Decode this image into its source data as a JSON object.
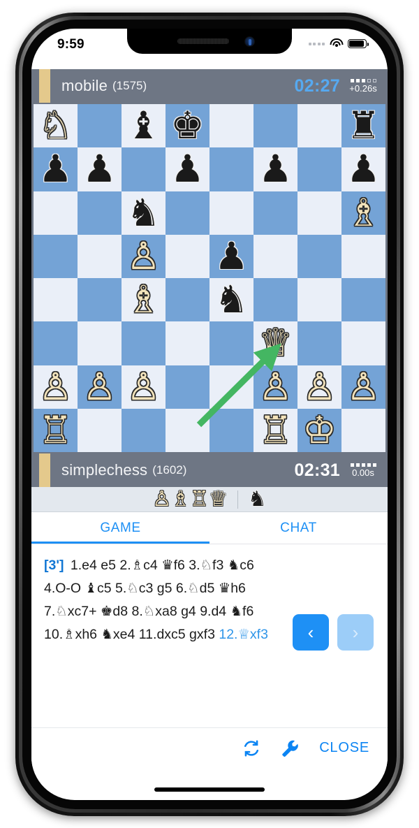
{
  "status_bar": {
    "time": "9:59",
    "signal_icon": "signal-dots-icon",
    "wifi_icon": "wifi-icon",
    "battery_icon": "battery-icon"
  },
  "top_player": {
    "name": "mobile",
    "rating": "(1575)",
    "clock": "02:27",
    "increment": "+0.26s",
    "ticks_filled": 3,
    "ticks_total": 5,
    "accent_color": "#e4c98c",
    "clock_color": "#56a9f0"
  },
  "bottom_player": {
    "name": "simplechess",
    "rating": "(1602)",
    "clock": "02:31",
    "increment": "0.00s",
    "ticks_filled": 5,
    "ticks_total": 5,
    "accent_color": "#e4c98c",
    "clock_color": "#ffffff"
  },
  "board": {
    "light_square_color": "#eaeff8",
    "dark_square_color": "#74a3d6",
    "orientation": "white-bottom",
    "last_move_arrow": {
      "from": "d1",
      "to": "f3",
      "color": "#44b662"
    },
    "ranks": [
      [
        {
          "sq": "a8",
          "piece": "white-knight",
          "glyph": "♘",
          "color": "white"
        },
        {
          "sq": "b8",
          "piece": null
        },
        {
          "sq": "c8",
          "piece": "black-bishop",
          "glyph": "♝",
          "color": "black"
        },
        {
          "sq": "d8",
          "piece": "black-king",
          "glyph": "♚",
          "color": "black"
        },
        {
          "sq": "e8",
          "piece": null
        },
        {
          "sq": "f8",
          "piece": null
        },
        {
          "sq": "g8",
          "piece": null
        },
        {
          "sq": "h8",
          "piece": "black-rook",
          "glyph": "♜",
          "color": "black"
        }
      ],
      [
        {
          "sq": "a7",
          "piece": "black-pawn",
          "glyph": "♟",
          "color": "black"
        },
        {
          "sq": "b7",
          "piece": "black-pawn",
          "glyph": "♟",
          "color": "black"
        },
        {
          "sq": "c7",
          "piece": null
        },
        {
          "sq": "d7",
          "piece": "black-pawn",
          "glyph": "♟",
          "color": "black"
        },
        {
          "sq": "e7",
          "piece": null
        },
        {
          "sq": "f7",
          "piece": "black-pawn",
          "glyph": "♟",
          "color": "black"
        },
        {
          "sq": "g7",
          "piece": null
        },
        {
          "sq": "h7",
          "piece": "black-pawn",
          "glyph": "♟",
          "color": "black"
        }
      ],
      [
        {
          "sq": "a6",
          "piece": null
        },
        {
          "sq": "b6",
          "piece": null
        },
        {
          "sq": "c6",
          "piece": "black-knight",
          "glyph": "♞",
          "color": "black"
        },
        {
          "sq": "d6",
          "piece": null
        },
        {
          "sq": "e6",
          "piece": null
        },
        {
          "sq": "f6",
          "piece": null
        },
        {
          "sq": "g6",
          "piece": null
        },
        {
          "sq": "h6",
          "piece": "white-bishop",
          "glyph": "♗",
          "color": "white"
        }
      ],
      [
        {
          "sq": "a5",
          "piece": null
        },
        {
          "sq": "b5",
          "piece": null
        },
        {
          "sq": "c5",
          "piece": "white-pawn",
          "glyph": "♙",
          "color": "white"
        },
        {
          "sq": "d5",
          "piece": null
        },
        {
          "sq": "e5",
          "piece": "black-pawn",
          "glyph": "♟",
          "color": "black"
        },
        {
          "sq": "f5",
          "piece": null
        },
        {
          "sq": "g5",
          "piece": null
        },
        {
          "sq": "h5",
          "piece": null
        }
      ],
      [
        {
          "sq": "a4",
          "piece": null
        },
        {
          "sq": "b4",
          "piece": null
        },
        {
          "sq": "c4",
          "piece": "white-bishop",
          "glyph": "♗",
          "color": "white"
        },
        {
          "sq": "d4",
          "piece": null
        },
        {
          "sq": "e4",
          "piece": "black-knight",
          "glyph": "♞",
          "color": "black"
        },
        {
          "sq": "f4",
          "piece": null
        },
        {
          "sq": "g4",
          "piece": null
        },
        {
          "sq": "h4",
          "piece": null
        }
      ],
      [
        {
          "sq": "a3",
          "piece": null
        },
        {
          "sq": "b3",
          "piece": null
        },
        {
          "sq": "c3",
          "piece": null
        },
        {
          "sq": "d3",
          "piece": null
        },
        {
          "sq": "e3",
          "piece": null
        },
        {
          "sq": "f3",
          "piece": "white-queen",
          "glyph": "♕",
          "color": "white"
        },
        {
          "sq": "g3",
          "piece": null
        },
        {
          "sq": "h3",
          "piece": null
        }
      ],
      [
        {
          "sq": "a2",
          "piece": "white-pawn",
          "glyph": "♙",
          "color": "white"
        },
        {
          "sq": "b2",
          "piece": "white-pawn",
          "glyph": "♙",
          "color": "white"
        },
        {
          "sq": "c2",
          "piece": "white-pawn",
          "glyph": "♙",
          "color": "white"
        },
        {
          "sq": "d2",
          "piece": null
        },
        {
          "sq": "e2",
          "piece": null
        },
        {
          "sq": "f2",
          "piece": "white-pawn",
          "glyph": "♙",
          "color": "white"
        },
        {
          "sq": "g2",
          "piece": "white-pawn",
          "glyph": "♙",
          "color": "white"
        },
        {
          "sq": "h2",
          "piece": "white-pawn",
          "glyph": "♙",
          "color": "white"
        }
      ],
      [
        {
          "sq": "a1",
          "piece": "white-rook",
          "glyph": "♖",
          "color": "white"
        },
        {
          "sq": "b1",
          "piece": null
        },
        {
          "sq": "c1",
          "piece": null
        },
        {
          "sq": "d1",
          "piece": null
        },
        {
          "sq": "e1",
          "piece": null
        },
        {
          "sq": "f1",
          "piece": "white-rook",
          "glyph": "♖",
          "color": "white"
        },
        {
          "sq": "g1",
          "piece": "white-king",
          "glyph": "♔",
          "color": "white"
        },
        {
          "sq": "h1",
          "piece": null
        }
      ]
    ]
  },
  "captured": {
    "left": [
      {
        "piece": "white-pawn",
        "glyph": "♙",
        "color": "white"
      },
      {
        "piece": "white-bishop",
        "glyph": "♗",
        "color": "white"
      },
      {
        "piece": "white-rook",
        "glyph": "♖",
        "color": "white"
      },
      {
        "piece": "white-queen",
        "glyph": "♕",
        "color": "white"
      }
    ],
    "right": [
      {
        "piece": "black-knight",
        "glyph": "♞",
        "color": "black"
      }
    ]
  },
  "tabs": [
    {
      "label": "GAME",
      "active": true
    },
    {
      "label": "CHAT",
      "active": false
    }
  ],
  "moves": {
    "time_tag": "[3']",
    "lines": [
      " 1.e4 e5 2.♗c4 ♛f6 3.♘f3 ♞c6",
      "4.O-O ♝c5 5.♘c3 g5 6.♘d5 ♛h6",
      "7.♘xc7+ ♚d8 8.♘xa8 g4 9.d4 ♞f6",
      "10.♗xh6 ♞xe4 11.dxc5 gxf3 "
    ],
    "current_move": "12.♕xf3"
  },
  "nav": {
    "prev_label": "‹",
    "next_label": "›",
    "prev_enabled": true,
    "next_enabled": false,
    "active_color": "#1e90f5",
    "disabled_color": "#9ccdf8"
  },
  "toolbar": {
    "refresh_icon": "rotate-refresh-icon",
    "settings_icon": "wrench-icon",
    "close_label": "CLOSE",
    "accent_color": "#0b84f3"
  }
}
